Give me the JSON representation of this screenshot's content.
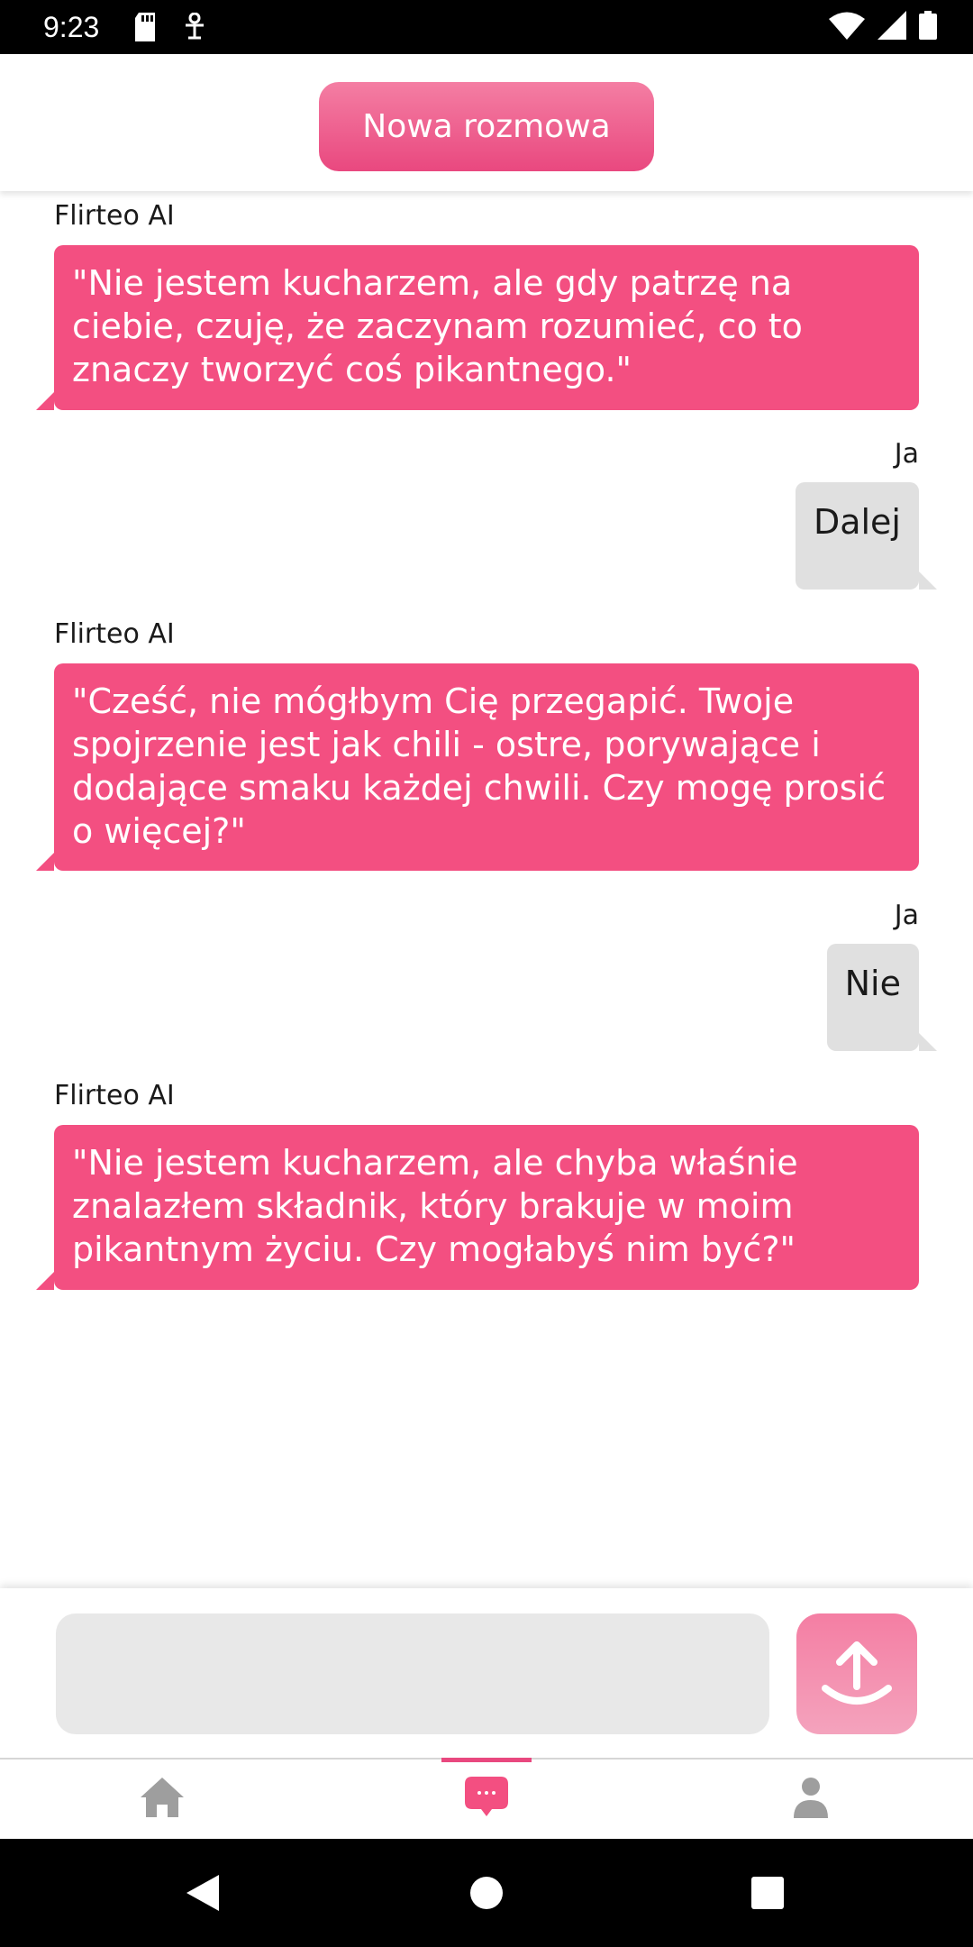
{
  "status_bar": {
    "time": "9:23",
    "left_icons": [
      "sd-card-icon",
      "accessibility-icon"
    ],
    "right_icons": [
      "wifi-icon",
      "signal-icon",
      "battery-icon"
    ]
  },
  "header": {
    "new_chat_label": "Nowa rozmowa"
  },
  "messages": [
    {
      "sender": "Flirteo AI",
      "role": "ai",
      "text": "\"Nie jestem kucharzem, ale gdy patrzę na ciebie, czuję, że zaczynam rozumieć, co to znaczy tworzyć coś pikantnego.\""
    },
    {
      "sender": "Ja",
      "role": "user",
      "text": "Dalej"
    },
    {
      "sender": "Flirteo AI",
      "role": "ai",
      "text": "\"Cześć, nie mógłbym Cię przegapić. Twoje spojrzenie jest jak chili - ostre, porywające i dodające smaku każdej chwili. Czy mogę prosić o więcej?\""
    },
    {
      "sender": "Ja",
      "role": "user",
      "text": "Nie"
    },
    {
      "sender": "Flirteo AI",
      "role": "ai",
      "text": "\"Nie jestem kucharzem, ale chyba właśnie znalazłem składnik, który brakuje w moim pikantnym życiu. Czy mogłabyś nim być?\""
    }
  ],
  "composer": {
    "input_value": "",
    "placeholder": "",
    "send_icon": "upload-arrow-icon"
  },
  "tabs": [
    {
      "icon": "home-icon",
      "active": false
    },
    {
      "icon": "chat-icon",
      "active": true
    },
    {
      "icon": "profile-icon",
      "active": false
    }
  ],
  "colors": {
    "accent": "#f34f81",
    "accent_light": "#f47ea3",
    "user_bubble": "#e0e0e0",
    "inactive_icon": "#9e9e9e"
  }
}
